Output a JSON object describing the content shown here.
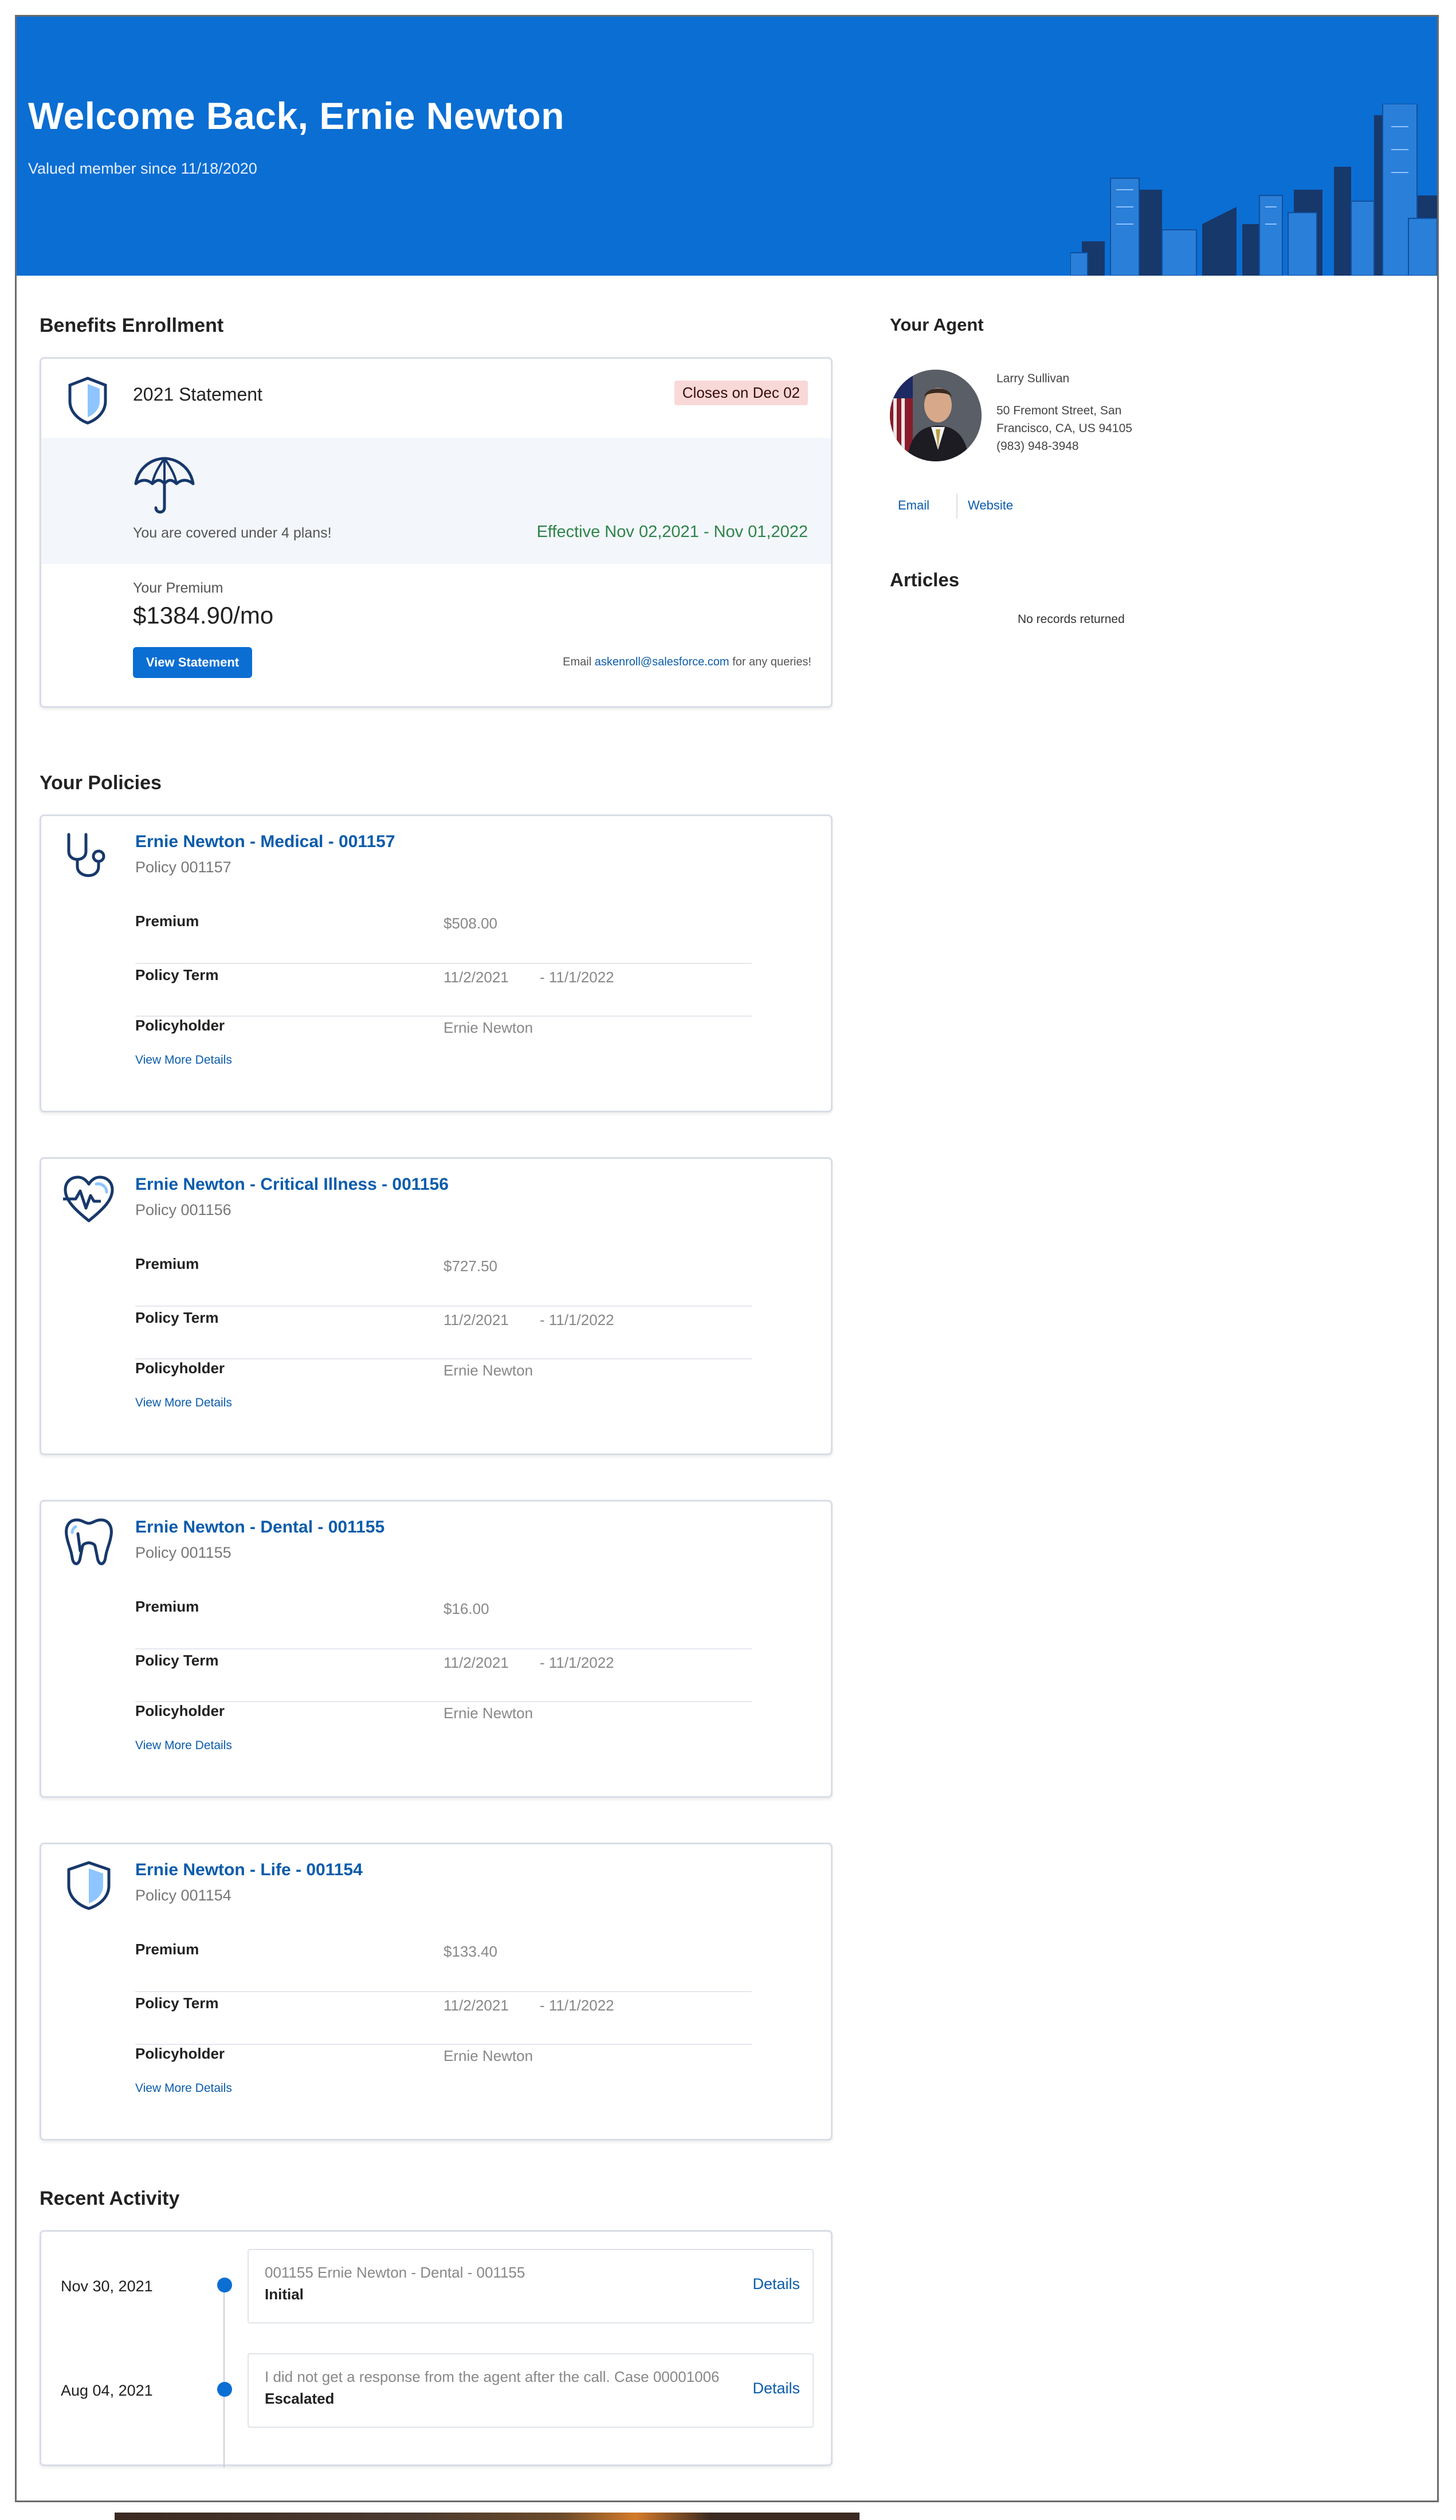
{
  "hero": {
    "title": "Welcome Back, Ernie Newton",
    "subtitle": "Valued member since 11/18/2020",
    "bg_color": "#0b6ed3"
  },
  "benefits": {
    "section_title": "Benefits Enrollment",
    "statement_title": "2021 Statement",
    "closes_badge": "Closes on Dec 02",
    "covered_text": "You are covered under 4 plans!",
    "effective_text": "Effective Nov 02,2021 - Nov 01,2022",
    "premium_label": "Your Premium",
    "premium_value": "$1384.90/mo",
    "view_statement_label": "View Statement",
    "email_prefix": "Email",
    "email_link": "askenroll@salesforce.com",
    "email_suffix": "for any queries!",
    "icons": {
      "shield": "shield-icon",
      "umbrella": "umbrella-icon"
    }
  },
  "agent": {
    "section_title": "Your Agent",
    "name": "Larry Sullivan",
    "address_line1": "50 Fremont Street, San",
    "address_line2": "Francisco, CA, US 94105",
    "phone": "(983) 948-3948",
    "email_label": "Email",
    "website_label": "Website"
  },
  "articles": {
    "section_title": "Articles",
    "empty_text": "No records returned"
  },
  "policies": {
    "section_title": "Your Policies",
    "labels": {
      "premium": "Premium",
      "term": "Policy Term",
      "holder": "Policyholder",
      "more": "View More Details"
    },
    "items": [
      {
        "title": "Ernie Newton - Medical - 001157",
        "subtitle": "Policy 001157",
        "premium": "$508.00",
        "term_start": "11/2/2021",
        "term_end": "- 11/1/2022",
        "holder": "Ernie Newton",
        "icon": "stethoscope-icon"
      },
      {
        "title": "Ernie Newton - Critical Illness - 001156",
        "subtitle": "Policy 001156",
        "premium": "$727.50",
        "term_start": "11/2/2021",
        "term_end": "- 11/1/2022",
        "holder": "Ernie Newton",
        "icon": "heartbeat-icon"
      },
      {
        "title": "Ernie Newton - Dental - 001155",
        "subtitle": "Policy 001155",
        "premium": "$16.00",
        "term_start": "11/2/2021",
        "term_end": "- 11/1/2022",
        "holder": "Ernie Newton",
        "icon": "tooth-icon"
      },
      {
        "title": "Ernie Newton - Life - 001154",
        "subtitle": "Policy 001154",
        "premium": "$133.40",
        "term_start": "11/2/2021",
        "term_end": "- 11/1/2022",
        "holder": "Ernie Newton",
        "icon": "shield-icon"
      }
    ]
  },
  "activity": {
    "section_title": "Recent Activity",
    "details_label": "Details",
    "items": [
      {
        "date": "Nov 30, 2021",
        "text": "001155 Ernie Newton - Dental - 001155",
        "status": "Initial"
      },
      {
        "date": "Aug 04, 2021",
        "text": "I did not get a response from the agent after the call. Case 00001006",
        "status": "Escalated"
      }
    ]
  }
}
